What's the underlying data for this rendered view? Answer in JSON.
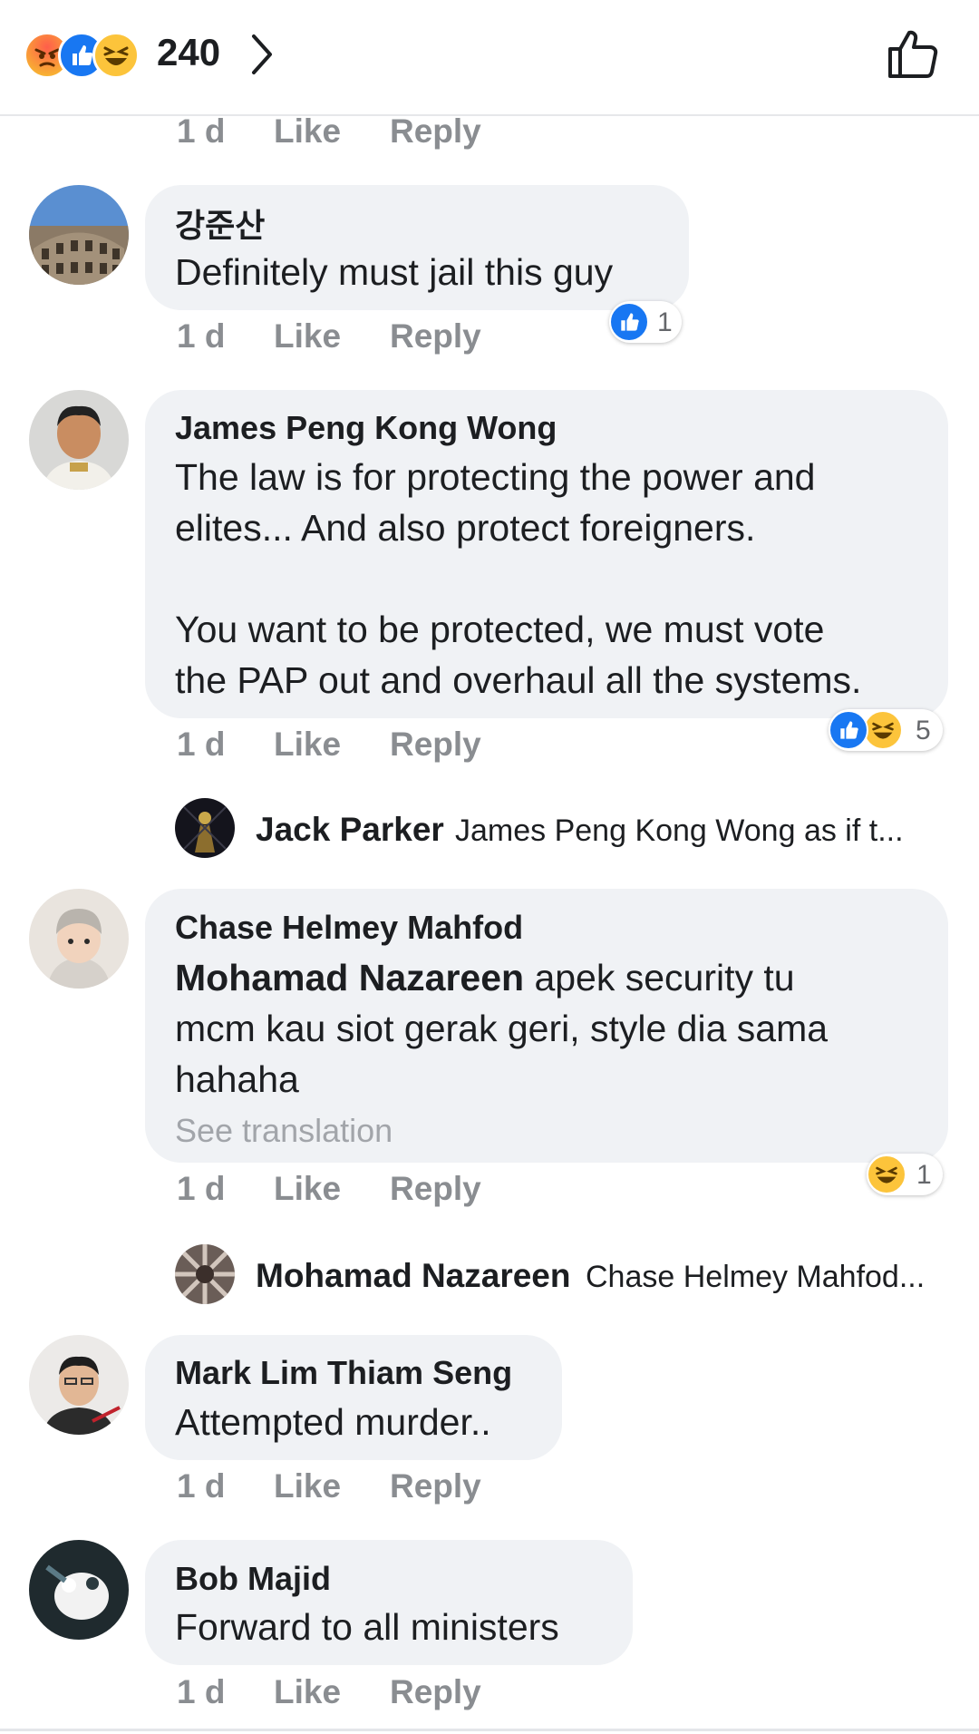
{
  "header": {
    "reaction_count": "240",
    "reaction_icons": [
      "angry-icon",
      "like-icon",
      "haha-icon"
    ],
    "chevron_icon": "chevron-right-icon",
    "like_icon": "thumbs-up-outline-icon"
  },
  "colors": {
    "meta_gray": "#8a8d91",
    "bubble_bg": "#f0f2f5",
    "like_blue": "#1877f2",
    "haha_yellow": "#fcc43b"
  },
  "top_meta": {
    "time": "1 d",
    "like": "Like",
    "reply": "Reply"
  },
  "comments": [
    {
      "name": "강준산",
      "lines": [
        "Definitely must jail this guy"
      ],
      "time": "1 d",
      "like": "Like",
      "reply": "Reply",
      "reaction_count": "1"
    },
    {
      "name": "James Peng Kong Wong",
      "lines": [
        "The law is for protecting the power and",
        "elites... And also protect foreigners.",
        "You want to be protected, we must vote",
        "the PAP out and overhaul all the systems."
      ],
      "time": "1 d",
      "like": "Like",
      "reply": "Reply",
      "reaction_count": "5",
      "reply_preview": {
        "name": "Jack Parker",
        "text": "James Peng Kong Wong as if t..."
      }
    },
    {
      "name": "Chase Helmey Mahfod",
      "mention": "Mohamad Nazareen",
      "lines": [
        " apek security tu",
        "mcm kau siot gerak geri, style dia sama",
        "hahaha"
      ],
      "see_translation": "See translation",
      "time": "1 d",
      "like": "Like",
      "reply": "Reply",
      "reaction_count": "1",
      "reply_preview": {
        "name": "Mohamad Nazareen",
        "text": "Chase Helmey Mahfod..."
      }
    },
    {
      "name": "Mark Lim Thiam Seng",
      "lines": [
        "Attempted murder.."
      ],
      "time": "1 d",
      "like": "Like",
      "reply": "Reply"
    },
    {
      "name": "Bob Majid",
      "lines": [
        "Forward to all ministers"
      ],
      "time": "1 d",
      "like": "Like",
      "reply": "Reply"
    }
  ]
}
